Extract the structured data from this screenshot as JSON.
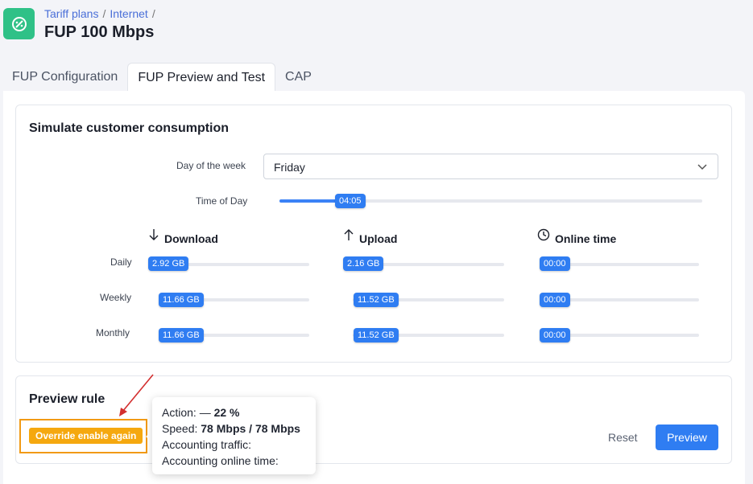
{
  "breadcrumb": {
    "items": [
      "Tariff plans",
      "Internet"
    ],
    "sep": "/"
  },
  "page_title": "FUP 100 Mbps",
  "tabs": [
    {
      "label": "FUP Configuration",
      "active": false
    },
    {
      "label": "FUP Preview and Test",
      "active": true
    },
    {
      "label": "CAP",
      "active": false
    }
  ],
  "simulate": {
    "title": "Simulate customer consumption",
    "day_label": "Day of the week",
    "day_value": "Friday",
    "time_label": "Time of Day",
    "time_value": "04:05",
    "time_fraction": 0.14,
    "columns": {
      "download": "Download",
      "upload": "Upload",
      "online": "Online time"
    },
    "rows": [
      {
        "label": "Daily",
        "download": "2.92 GB",
        "upload": "2.16 GB",
        "online": "00:00"
      },
      {
        "label": "Weekly",
        "download": "11.66 GB",
        "upload": "11.52 GB",
        "online": "00:00"
      },
      {
        "label": "Monthly",
        "download": "11.66 GB",
        "upload": "11.52 GB",
        "online": "00:00"
      }
    ]
  },
  "preview": {
    "title": "Preview rule",
    "badge": "Override enable again",
    "tooltip": {
      "action_label": "Action:",
      "action_dash": "—",
      "action_value": "22 %",
      "speed_label": "Speed:",
      "speed_value": "78 Mbps / 78 Mbps",
      "acc_traffic": "Accounting traffic:",
      "acc_online": "Accounting online time:"
    },
    "reset": "Reset",
    "preview_btn": "Preview"
  },
  "colors": {
    "accent": "#2f7df2",
    "logo": "#2fc187",
    "warning": "#f5a80f",
    "annotation": "#d32f2f"
  }
}
